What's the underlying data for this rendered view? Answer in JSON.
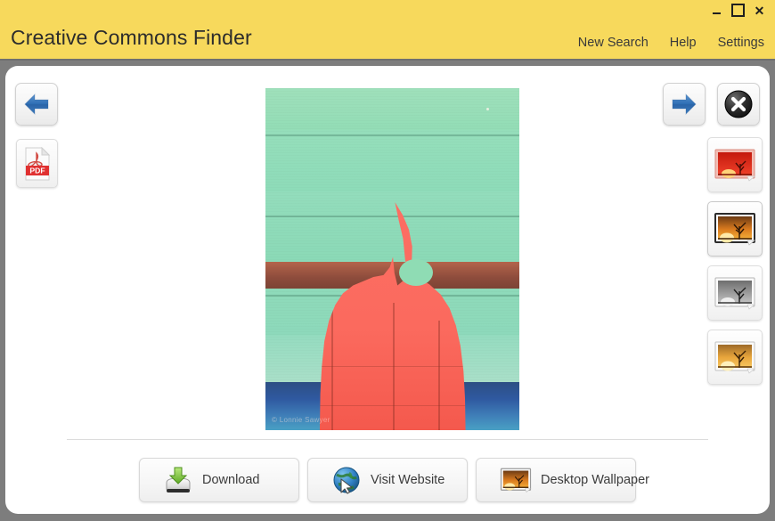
{
  "window": {
    "title": "Creative Commons Finder",
    "controls": {
      "minimize": "minimize",
      "maximize": "maximize",
      "close": "✕"
    },
    "titlebar_color": "#f7d95c",
    "frame_color": "#7d7d7d",
    "panel_color": "#ffffff"
  },
  "menu": {
    "items": [
      {
        "label": "New Search",
        "name": "menu-new-search"
      },
      {
        "label": "Help",
        "name": "menu-help"
      },
      {
        "label": "Settings",
        "name": "menu-settings"
      }
    ]
  },
  "nav": {
    "back": {
      "icon": "arrow-left-icon",
      "color": "#2f6fb5"
    },
    "forward": {
      "icon": "arrow-right-icon",
      "color": "#2f6fb5"
    },
    "close": {
      "icon": "close-circle-icon",
      "color": "#2b2b2b"
    }
  },
  "tools": {
    "pdf": {
      "icon": "pdf-file-icon",
      "label": "PDF",
      "color": "#e03030"
    }
  },
  "viewer": {
    "image": {
      "alt": "Coral painted wooden sailboat cutout on mint green wood siding",
      "watermark": "© Lonnie Sawyer",
      "background_color": "#8fdcb4",
      "subject_color": "#fb6a5e"
    }
  },
  "thumbnails": [
    {
      "name": "thumbnail-1",
      "title": "red sunset tree",
      "selected": false,
      "sky_top": "#c41a0e",
      "sky_bottom": "#f0412a",
      "sun": "#ffd27a",
      "frame": "#e9a79c"
    },
    {
      "name": "thumbnail-2",
      "title": "orange sunset tree",
      "selected": true,
      "sky_top": "#6b3a14",
      "sky_bottom": "#f09a2a",
      "sun": "#ffe9a8",
      "frame": "#2b2b2b"
    },
    {
      "name": "thumbnail-3",
      "title": "grayscale sunset tree",
      "selected": false,
      "sky_top": "#6e6e6e",
      "sky_bottom": "#b8b8b8",
      "sun": "#efefef",
      "frame": "#9a9a9a"
    },
    {
      "name": "thumbnail-4",
      "title": "golden sunset tree",
      "selected": false,
      "sky_top": "#8a5a22",
      "sky_bottom": "#f5b544",
      "sun": "#fff0bb",
      "frame": "#b9b9b9"
    }
  ],
  "actions": [
    {
      "name": "download-button",
      "label": "Download",
      "icon": "download-drive-icon"
    },
    {
      "name": "visit-website-button",
      "label": "Visit Website",
      "icon": "globe-cursor-icon"
    },
    {
      "name": "desktop-wallpaper-button",
      "label": "Desktop Wallpaper",
      "icon": "wallpaper-image-icon"
    }
  ]
}
